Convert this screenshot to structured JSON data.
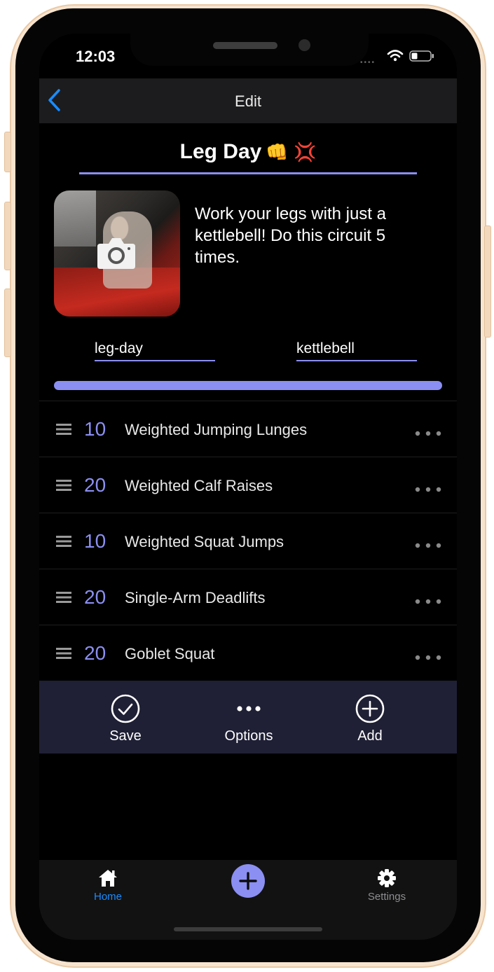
{
  "status_bar": {
    "time": "12:03"
  },
  "nav": {
    "title": "Edit"
  },
  "workout": {
    "title": "Leg Day",
    "emoji": "👊 💢",
    "description": "Work your legs with just a kettlebell!  Do this circuit 5 times.",
    "tags": [
      "leg-day",
      "kettlebell"
    ]
  },
  "exercises": [
    {
      "reps": "10",
      "name": "Weighted Jumping Lunges"
    },
    {
      "reps": "20",
      "name": "Weighted Calf Raises"
    },
    {
      "reps": "10",
      "name": "Weighted Squat Jumps"
    },
    {
      "reps": "20",
      "name": "Single-Arm Deadlifts"
    },
    {
      "reps": "20",
      "name": "Goblet Squat"
    }
  ],
  "actions": {
    "save": "Save",
    "options": "Options",
    "add": "Add"
  },
  "tabbar": {
    "home": "Home",
    "settings": "Settings"
  },
  "colors": {
    "accent": "#8b8ff2",
    "ios_blue": "#1a8cff",
    "action_bar": "#1f2035",
    "background": "#000000",
    "shell": "#f7e4cf"
  },
  "icons": {
    "back": "chevron-left-icon",
    "camera": "camera-icon",
    "drag": "drag-handle-icon",
    "more": "more-horizontal-icon",
    "save": "check-circle-icon",
    "options": "ellipsis-icon",
    "add": "plus-circle-icon",
    "home": "home-icon",
    "fab": "plus-icon",
    "settings": "gear-icon"
  }
}
